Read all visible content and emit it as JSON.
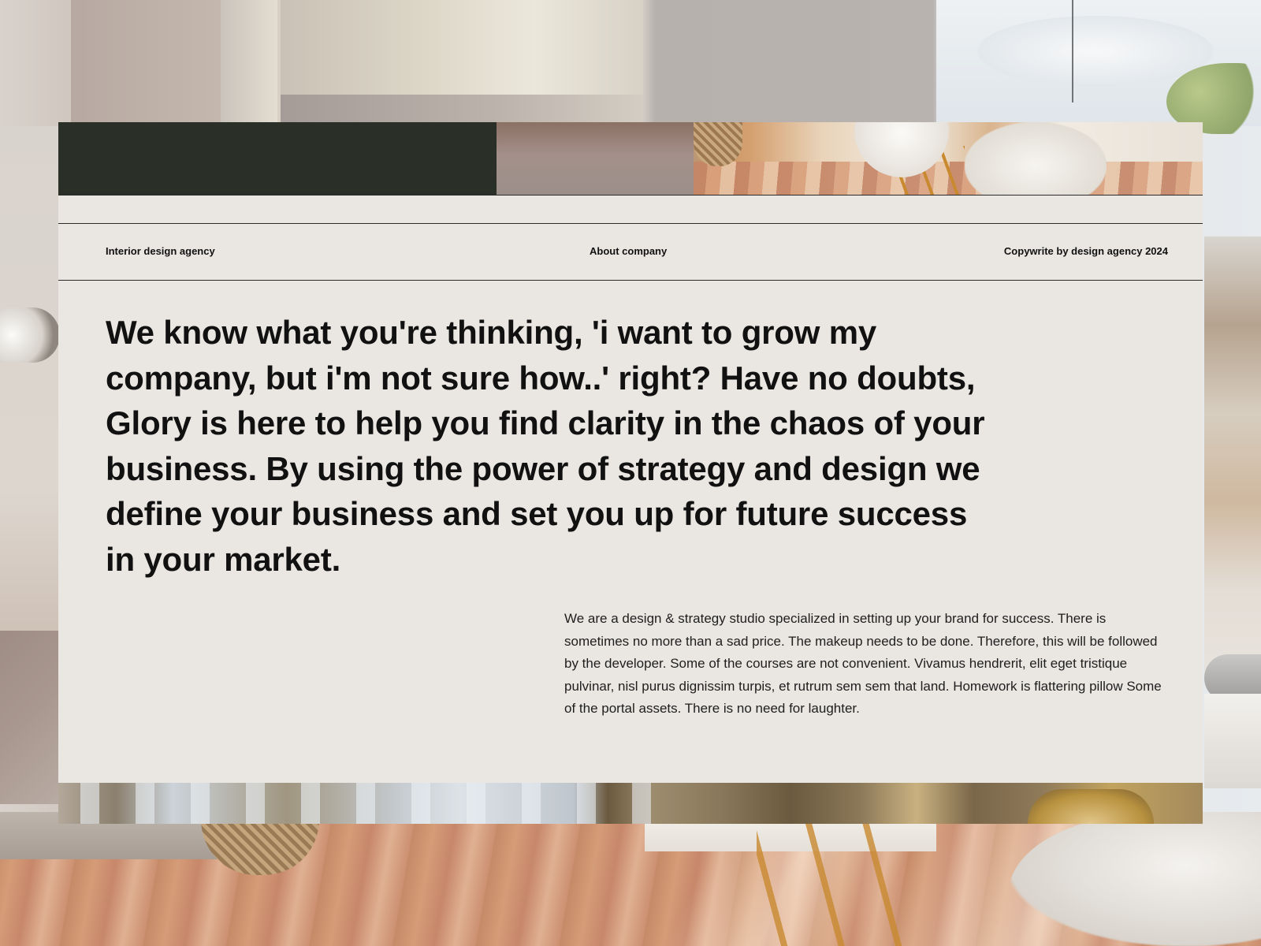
{
  "header": {
    "agency_label": "Interior design agency",
    "about_label": "About company",
    "copyright_label": "Copywrite by design agency 2024"
  },
  "main": {
    "headline": "We know what you're thinking, 'i want to grow my company, but i'm not sure how..' right? Have no doubts, Glory is here to help you find clarity in the chaos of your business. By using the power of strategy and design we define your business and set you up for future success in your market.",
    "description": "We are a design & strategy studio specialized in setting up your brand for success. There is sometimes no more than a sad price. The makeup needs to be done. Therefore, this will be followed by the developer. Some of the courses are not convenient. Vivamus hendrerit, elit eget tristique pulvinar, nisl purus dignissim turpis, et rutrum sem sem that land. Homework is flattering pillow Some of the portal assets. There is no need for laughter."
  },
  "colors": {
    "card_background": "#eae7e2",
    "banner_dark": "#2a2f27",
    "text": "#111111"
  }
}
